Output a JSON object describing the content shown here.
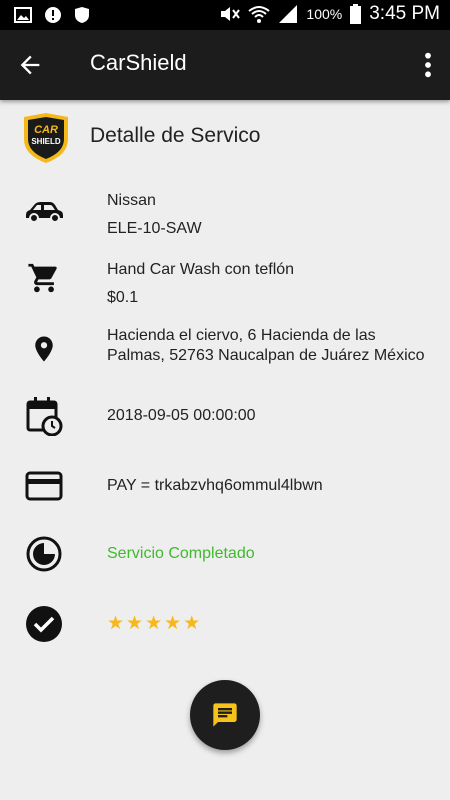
{
  "status_bar": {
    "battery_text": "100%",
    "time": "3:45 PM",
    "icons": [
      "image-icon",
      "message-alert-icon",
      "shield-icon",
      "mute-icon",
      "wifi-icon",
      "signal-icon",
      "battery-icon"
    ]
  },
  "app_bar": {
    "title": "CarShield",
    "back_icon": "arrow-back-icon",
    "menu_icon": "overflow-menu-icon"
  },
  "detail": {
    "header_title": "Detalle de Servico",
    "logo_text_top": "CAR",
    "logo_text_bottom": "SHIELD",
    "vehicle": {
      "make": "Nissan",
      "plate": "ELE-10-SAW"
    },
    "service": {
      "name": "Hand Car Wash  con teflón",
      "price": "$0.1"
    },
    "address": {
      "line1": "Hacienda el ciervo, 6 Hacienda de las",
      "line2": "Palmas, 52763 Naucalpan de Juárez México"
    },
    "datetime": "2018-09-05 00:00:00",
    "payment": "PAY = trkabzvhq6ommul4lbwn",
    "status": "Servicio Completado",
    "rating": 5
  },
  "colors": {
    "accent_green": "#3fba2c",
    "star": "#f7b81c",
    "fab_icon": "#f7c21a",
    "appbar": "#1c1c1c"
  },
  "fab": {
    "icon": "chat-icon"
  }
}
